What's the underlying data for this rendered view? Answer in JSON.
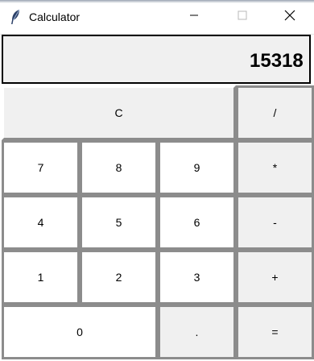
{
  "window": {
    "title": "Calculator"
  },
  "display": {
    "value": "15318"
  },
  "keys": {
    "clear": "C",
    "divide": "/",
    "seven": "7",
    "eight": "8",
    "nine": "9",
    "multiply": "*",
    "four": "4",
    "five": "5",
    "six": "6",
    "subtract": "-",
    "one": "1",
    "two": "2",
    "three": "3",
    "add": "+",
    "zero": "0",
    "decimal": ".",
    "equals": "="
  },
  "colors": {
    "key_bg": "#ffffff",
    "operator_bg": "#f0f0f0",
    "key_border": "#8c8c8c"
  },
  "icons": {
    "app": "feather-icon",
    "minimize": "minimize-icon",
    "maximize": "maximize-icon",
    "close": "close-icon"
  }
}
